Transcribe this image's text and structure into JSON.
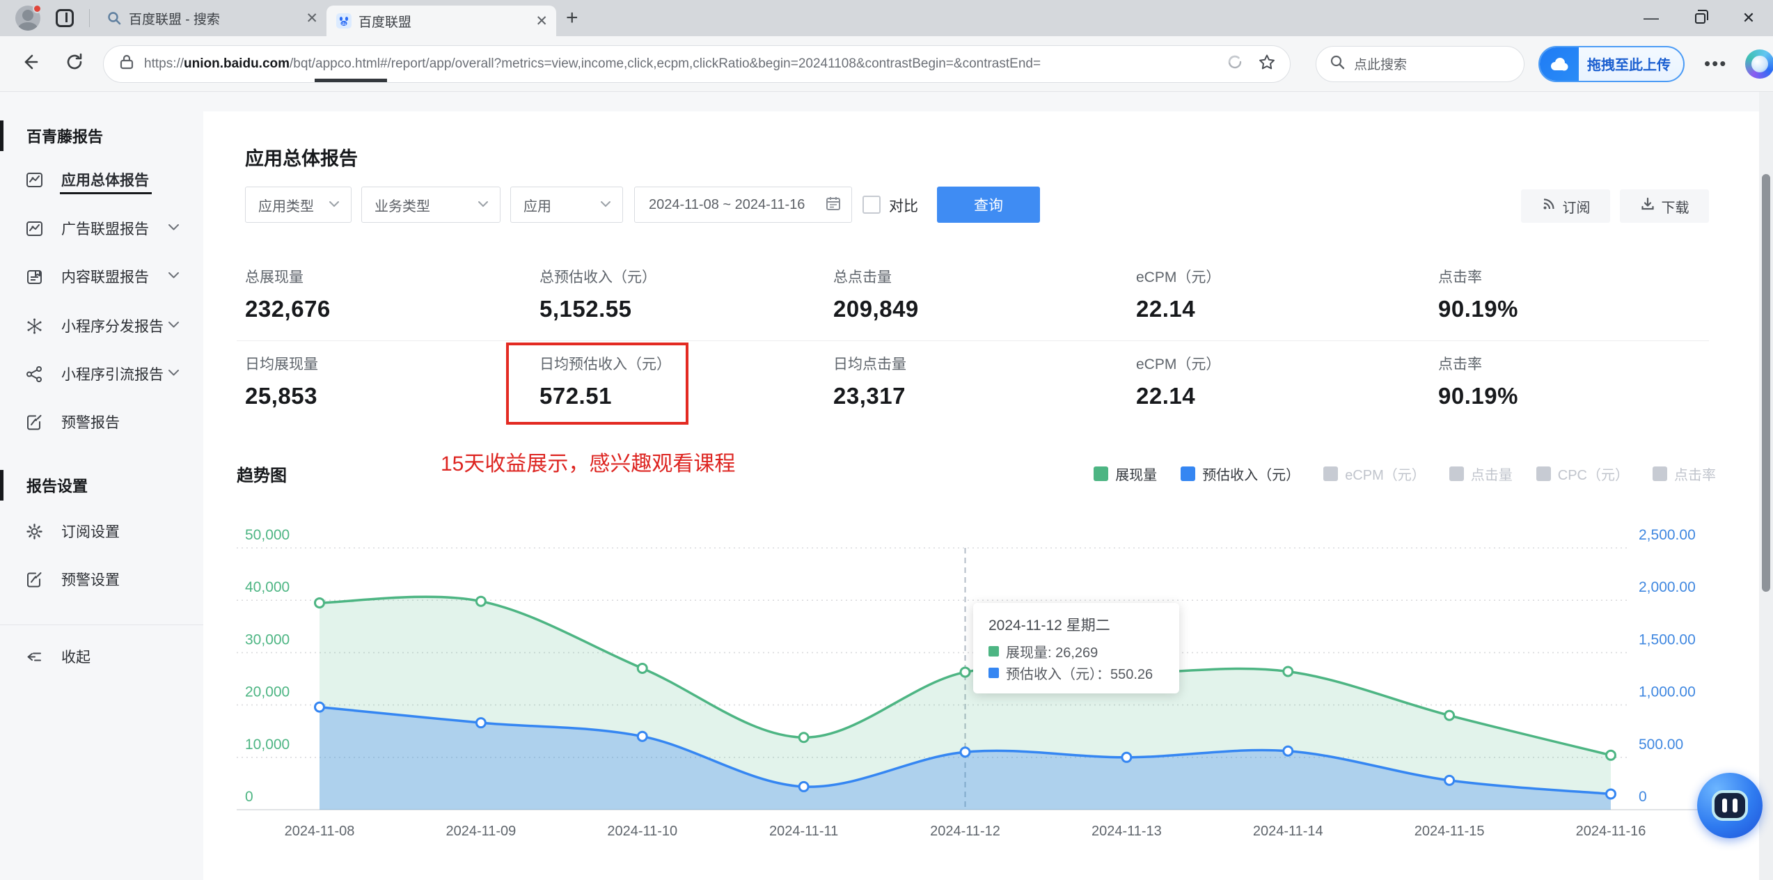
{
  "browser": {
    "tabs": [
      {
        "title": "百度联盟 - 搜索",
        "icon": "search-favicon",
        "active": false
      },
      {
        "title": "百度联盟",
        "icon": "baidu-favicon",
        "active": true
      }
    ],
    "url": {
      "scheme": "https://",
      "domain": "union.baidu.com",
      "path": "/bqt/appco.html#/report/app/overall?metrics=view,income,click,ecpm,clickRatio&begin=20241108&contrastBegin=&contrastEnd="
    },
    "search_placeholder": "点此搜索",
    "upload_button_label": "拖拽至此上传"
  },
  "sidebar": {
    "sections": [
      {
        "header": "百青藤报告",
        "items": [
          {
            "label": "应用总体报告",
            "icon": "report-chart-icon",
            "active": true,
            "chevron": false
          },
          {
            "label": "广告联盟报告",
            "icon": "report-chart-icon",
            "active": false,
            "chevron": true
          },
          {
            "label": "内容联盟报告",
            "icon": "content-report-icon",
            "active": false,
            "chevron": true
          },
          {
            "label": "小程序分发报告",
            "icon": "distribute-icon",
            "active": false,
            "chevron": true
          },
          {
            "label": "小程序引流报告",
            "icon": "share-icon",
            "active": false,
            "chevron": true
          },
          {
            "label": "预警报告",
            "icon": "alert-report-icon",
            "active": false,
            "chevron": false
          }
        ]
      },
      {
        "header": "报告设置",
        "items": [
          {
            "label": "订阅设置",
            "icon": "gear-icon",
            "active": false,
            "chevron": false
          },
          {
            "label": "预警设置",
            "icon": "alert-report-icon",
            "active": false,
            "chevron": false
          }
        ]
      }
    ],
    "collapse_label": "收起"
  },
  "report": {
    "title": "应用总体报告",
    "filters": {
      "app_type": "应用类型",
      "business_type": "业务类型",
      "app": "应用",
      "date_range": "2024-11-08 ~ 2024-11-16",
      "compare_label": "对比",
      "query_button": "查询",
      "subscribe_button": "订阅",
      "download_button": "下载"
    },
    "stats_rows": [
      [
        {
          "label": "总展现量",
          "value": "232,676"
        },
        {
          "label": "总预估收入（元）",
          "value": "5,152.55"
        },
        {
          "label": "总点击量",
          "value": "209,849"
        },
        {
          "label": "eCPM（元）",
          "value": "22.14"
        },
        {
          "label": "点击率",
          "value": "90.19%"
        }
      ],
      [
        {
          "label": "日均展现量",
          "value": "25,853"
        },
        {
          "label": "日均预估收入（元）",
          "value": "572.51",
          "highlighted": true
        },
        {
          "label": "日均点击量",
          "value": "23,317"
        },
        {
          "label": "eCPM（元）",
          "value": "22.14"
        },
        {
          "label": "点击率",
          "value": "90.19%"
        }
      ]
    ],
    "annotation": "15天收益展示，感兴趣观看课程",
    "chart_title": "趋势图"
  },
  "chart_data": {
    "type": "area",
    "x": [
      "2024-11-08",
      "2024-11-09",
      "2024-11-10",
      "2024-11-11",
      "2024-11-12",
      "2024-11-13",
      "2024-11-14",
      "2024-11-15",
      "2024-11-16"
    ],
    "series": [
      {
        "name": "展现量",
        "axis": "left",
        "color": "#4db583",
        "fill": "rgba(77,181,131,0.16)",
        "values": [
          39500,
          39800,
          27000,
          13800,
          26269,
          26100,
          26400,
          18000,
          10400
        ]
      },
      {
        "name": "预估收入（元）",
        "axis": "right",
        "color": "#3586f2",
        "fill": "rgba(53,134,242,0.30)",
        "values": [
          980,
          830,
          700,
          220,
          550.26,
          500,
          560,
          280,
          150
        ]
      }
    ],
    "legend": [
      {
        "label": "展现量",
        "color": "#4db583",
        "active": true
      },
      {
        "label": "预估收入（元）",
        "color": "#3586f2",
        "active": true
      },
      {
        "label": "eCPM（元）",
        "active": false
      },
      {
        "label": "点击量",
        "active": false
      },
      {
        "label": "CPC（元）",
        "active": false
      },
      {
        "label": "点击率",
        "active": false
      }
    ],
    "left_axis": {
      "ticks": [
        "0",
        "10,000",
        "20,000",
        "30,000",
        "40,000",
        "50,000"
      ],
      "max": 50000,
      "color": "#4db583"
    },
    "right_axis": {
      "ticks": [
        "0",
        "500.00",
        "1,000.00",
        "1,500.00",
        "2,000.00",
        "2,500.00"
      ],
      "max": 2500,
      "color": "#3f87e0"
    },
    "grid": true,
    "tooltip": {
      "title": "2024-11-12 星期二",
      "x_index": 4,
      "rows": [
        {
          "color": "#4db583",
          "text": "展现量: 26,269"
        },
        {
          "color": "#3586f2",
          "text": "预估收入（元）：550.26"
        }
      ]
    }
  }
}
